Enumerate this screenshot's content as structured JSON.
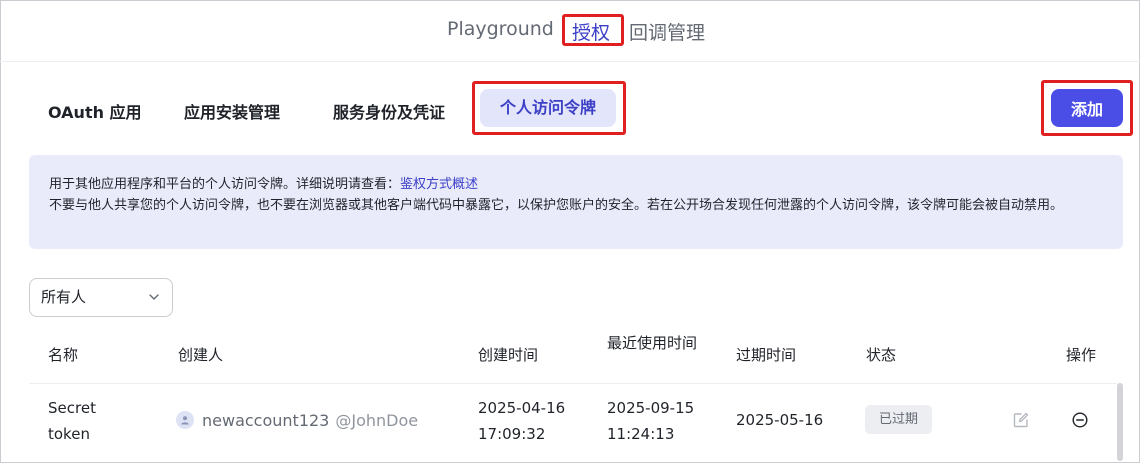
{
  "topnav": {
    "playground": "Playground",
    "auth": "授权",
    "callback": "回调管理"
  },
  "tabs": {
    "oauth": "OAuth 应用",
    "install": "应用安装管理",
    "service": "服务身份及凭证",
    "pat": "个人访问令牌"
  },
  "add_label": "添加",
  "info": {
    "line1_prefix": "用于其他应用程序和平台的个人访问令牌。详细说明请查看：",
    "line1_link": "鉴权方式概述",
    "line2": "不要与他人共享您的个人访问令牌，也不要在浏览器或其他客户端代码中暴露它，以保护您账户的安全。若在公开场合发现任何泄露的个人访问令牌，该令牌可能会被自动禁用。"
  },
  "owner_filter": "所有人",
  "table": {
    "headers": {
      "name": "名称",
      "creator": "创建人",
      "created": "创建时间",
      "last_used": "最近使用时间",
      "expire": "过期时间",
      "status": "状态",
      "ops": "操作"
    },
    "rows": [
      {
        "name": "Secret token",
        "creator_name": "newaccount123",
        "creator_handle": "@JohnDoe",
        "created_date": "2025-04-16",
        "created_time": "17:09:32",
        "last_used_date": "2025-09-15",
        "last_used_time": "11:24:13",
        "expire": "2025-05-16",
        "status": "已过期"
      }
    ]
  },
  "colors": {
    "accent": "#4b4ee6",
    "highlight": "#e02020",
    "info_bg": "#e9ebfb"
  }
}
